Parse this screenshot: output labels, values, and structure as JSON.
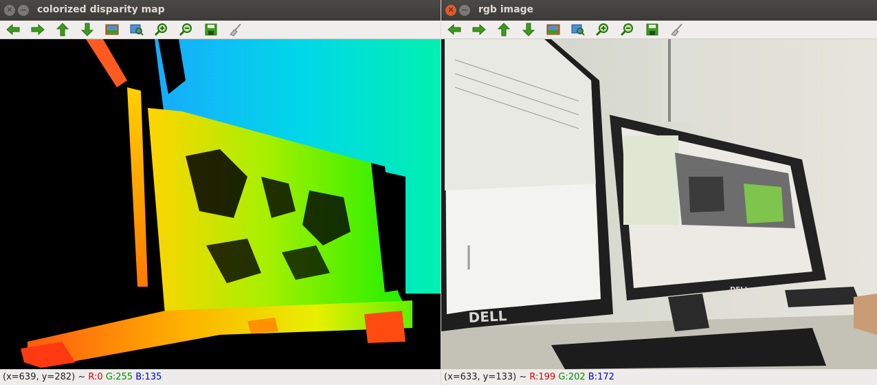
{
  "windows": {
    "left": {
      "title": "colorized disparity map",
      "status": {
        "coords": "(x=639, y=282)",
        "sep": " ~ ",
        "r": "R:0",
        "g": "G:255",
        "b": "B:135"
      }
    },
    "right": {
      "title": "rgb image",
      "status": {
        "coords": "(x=633, y=133)",
        "sep": " ~ ",
        "r": "R:199",
        "g": "G:202",
        "b": "B:172"
      },
      "scene_text": {
        "monitor_left_brand": "DELL",
        "monitor_right_brand": "DELL"
      }
    }
  },
  "toolbar_icons": [
    "arrow-left-icon",
    "arrow-right-icon",
    "arrow-up-icon",
    "arrow-down-icon",
    "zoom-fit-icon",
    "zoom-original-icon",
    "zoom-in-icon",
    "zoom-out-icon",
    "save-icon",
    "properties-icon"
  ],
  "colors": {
    "titlebar": "#3c3b37",
    "close_active": "#e05a2b",
    "toolbar_green": "#3c9a1d"
  }
}
